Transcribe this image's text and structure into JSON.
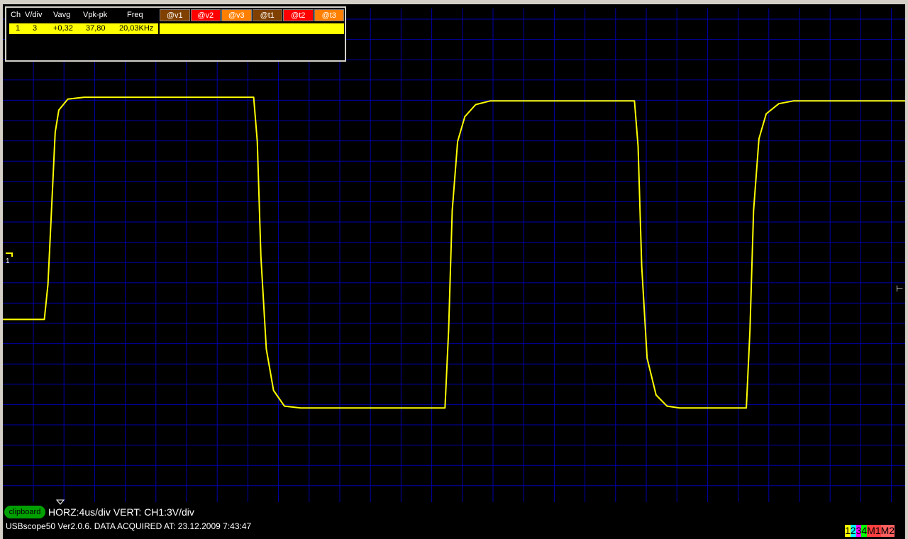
{
  "measurements": {
    "headers": [
      "Ch",
      "V/div",
      "Vavg",
      "Vpk-pk",
      "Freq"
    ],
    "row": {
      "ch": "1",
      "vdiv": "3",
      "vavg": "+0,32",
      "vpkpk": "37,80",
      "freq": "20,03KHz"
    },
    "cursor_headers": [
      {
        "label": "@v1",
        "color": "#804000"
      },
      {
        "label": "@v2",
        "color": "#ff0000"
      },
      {
        "label": "@v3",
        "color": "#ff8000"
      },
      {
        "label": "@t1",
        "color": "#804000"
      },
      {
        "label": "@t2",
        "color": "#ff0000"
      },
      {
        "label": "@t3",
        "color": "#ff8000"
      }
    ]
  },
  "status": {
    "clipboard_button": "clipboard",
    "scale_text": "HORZ:4us/div VERT: CH1:3V/div",
    "info_text": "USBscope50 Ver2.0.6.  DATA ACQUIRED AT: 23.12.2009 7:43:47"
  },
  "channel_legend": [
    {
      "label": "1",
      "fg": "#000000",
      "bg": "#ffff00"
    },
    {
      "label": "2",
      "fg": "#000000",
      "bg": "#00ffff"
    },
    {
      "label": "3",
      "fg": "#000000",
      "bg": "#ff00ff"
    },
    {
      "label": "4",
      "fg": "#000000",
      "bg": "#00ff00"
    },
    {
      "label": "M1",
      "fg": "#000000",
      "bg": "#ff4040"
    },
    {
      "label": "M2",
      "fg": "#000000",
      "bg": "#ff6060"
    }
  ],
  "markers": {
    "channel_ground_label": "1"
  },
  "colors": {
    "trace": "#ffff00",
    "grid": "#0000aa",
    "background": "#000000"
  },
  "chart_data": {
    "type": "line",
    "xlabel": "",
    "ylabel": "",
    "xlim": [
      0,
      40
    ],
    "ylim": [
      -15,
      15
    ],
    "grid": true,
    "series": [
      {
        "x": [
          0,
          2.3,
          2.5,
          2.7,
          2.9,
          3.1,
          3.6,
          4.5,
          13.9,
          14.1,
          14.3,
          14.6,
          15.0,
          15.6,
          16.5,
          20.0,
          24.5,
          24.7,
          24.9,
          25.2,
          25.6,
          26.2,
          27.0,
          35.0,
          35.2,
          35.4,
          35.7,
          36.2,
          36.8,
          37.5,
          41.2,
          41.4,
          41.6,
          41.9,
          42.3,
          43.0,
          43.8,
          50.0
        ],
        "y": [
          -6.8,
          -6.8,
          -3.0,
          5.2,
          13.5,
          15.9,
          17.1,
          17.3,
          17.3,
          12.5,
          0.0,
          -10.0,
          -14.5,
          -16.2,
          -16.4,
          -16.4,
          -16.4,
          -8.0,
          5.0,
          12.5,
          15.2,
          16.5,
          16.9,
          16.9,
          12.0,
          -1.0,
          -11.0,
          -15.0,
          -16.2,
          -16.4,
          -16.4,
          -8.0,
          5.0,
          12.8,
          15.5,
          16.6,
          16.9,
          16.9
        ]
      }
    ]
  }
}
